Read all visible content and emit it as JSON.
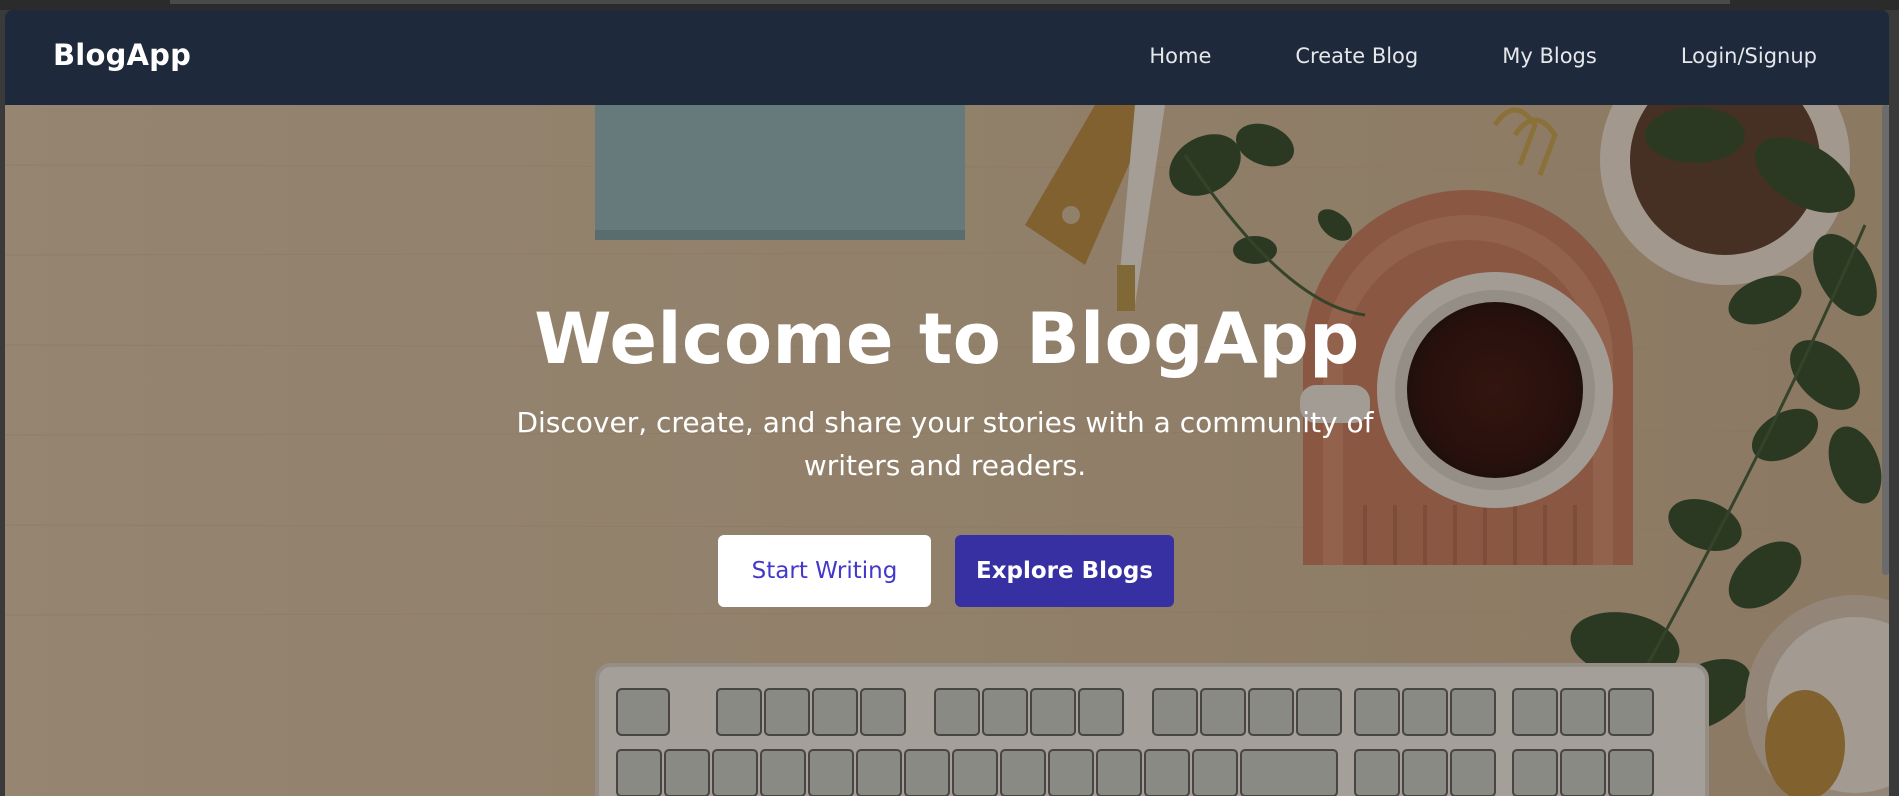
{
  "app": {
    "brand": "BlogApp"
  },
  "nav": {
    "items": [
      {
        "label": "Home"
      },
      {
        "label": "Create Blog"
      },
      {
        "label": "My Blogs"
      },
      {
        "label": "Login/Signup"
      }
    ]
  },
  "hero": {
    "title": "Welcome to BlogApp",
    "subtitle": "Discover, create, and share your stories with a community of writers and readers.",
    "primary_button": "Start Writing",
    "secondary_button": "Explore Blogs"
  },
  "colors": {
    "navbar_bg": "#1e293b",
    "primary_button_text": "#4338ca",
    "secondary_button_bg": "#3730a3"
  }
}
